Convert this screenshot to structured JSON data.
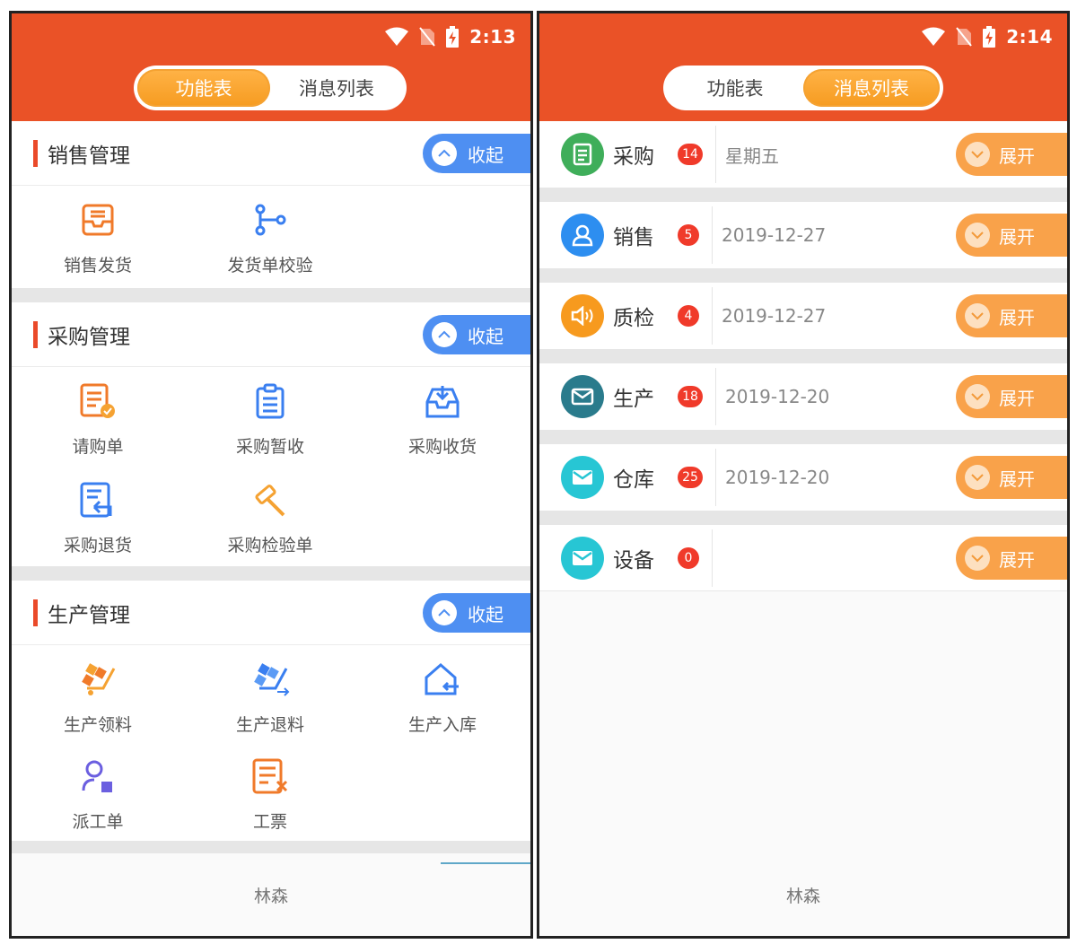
{
  "left_screen": {
    "status": {
      "time": "2:13"
    },
    "tabs": [
      {
        "label": "功能表",
        "active": true
      },
      {
        "label": "消息列表",
        "active": false
      }
    ],
    "sections": [
      {
        "title": "销售管理",
        "collapse_label": "收起",
        "items": [
          {
            "label": "销售发货",
            "icon": "inbox-tray-icon"
          },
          {
            "label": "发货单校验",
            "icon": "branch-flow-icon"
          }
        ]
      },
      {
        "title": "采购管理",
        "collapse_label": "收起",
        "items": [
          {
            "label": "请购单",
            "icon": "request-doc-icon"
          },
          {
            "label": "采购暂收",
            "icon": "clipboard-icon"
          },
          {
            "label": "采购收货",
            "icon": "receive-box-icon"
          },
          {
            "label": "采购退货",
            "icon": "return-doc-icon"
          },
          {
            "label": "采购检验单",
            "icon": "hammer-icon"
          }
        ]
      },
      {
        "title": "生产管理",
        "collapse_label": "收起",
        "items": [
          {
            "label": "生产领料",
            "icon": "cart-boxes-icon"
          },
          {
            "label": "生产退料",
            "icon": "cart-return-icon"
          },
          {
            "label": "生产入库",
            "icon": "house-in-icon"
          },
          {
            "label": "派工单",
            "icon": "worker-icon"
          },
          {
            "label": "工票",
            "icon": "ticket-doc-icon"
          }
        ]
      }
    ],
    "footer_name": "林森"
  },
  "right_screen": {
    "status": {
      "time": "2:14"
    },
    "tabs": [
      {
        "label": "功能表",
        "active": false
      },
      {
        "label": "消息列表",
        "active": true
      }
    ],
    "messages": [
      {
        "title": "采购",
        "badge": "14",
        "date": "星期五",
        "icon": "list-doc-icon",
        "color": "#3fae5a",
        "expand_label": "展开"
      },
      {
        "title": "销售",
        "badge": "5",
        "date": "2019-12-27",
        "icon": "person-icon",
        "color": "#2d8ef0",
        "expand_label": "展开"
      },
      {
        "title": "质检",
        "badge": "4",
        "date": "2019-12-27",
        "icon": "speaker-icon",
        "color": "#f79a1e",
        "expand_label": "展开"
      },
      {
        "title": "生产",
        "badge": "18",
        "date": "2019-12-20",
        "icon": "mail-icon",
        "color": "#2a7b8c",
        "expand_label": "展开"
      },
      {
        "title": "仓库",
        "badge": "25",
        "date": "2019-12-20",
        "icon": "mail-icon",
        "color": "#27c6d4",
        "expand_label": "展开"
      },
      {
        "title": "设备",
        "badge": "0",
        "date": "",
        "icon": "mail-icon",
        "color": "#27c6d4",
        "expand_label": "展开"
      }
    ],
    "footer_name": "林森"
  },
  "colors": {
    "appbar": "#ea5227",
    "collapse": "#4e8ff2",
    "expand": "#f9a24a",
    "badge": "#f03a2a"
  }
}
